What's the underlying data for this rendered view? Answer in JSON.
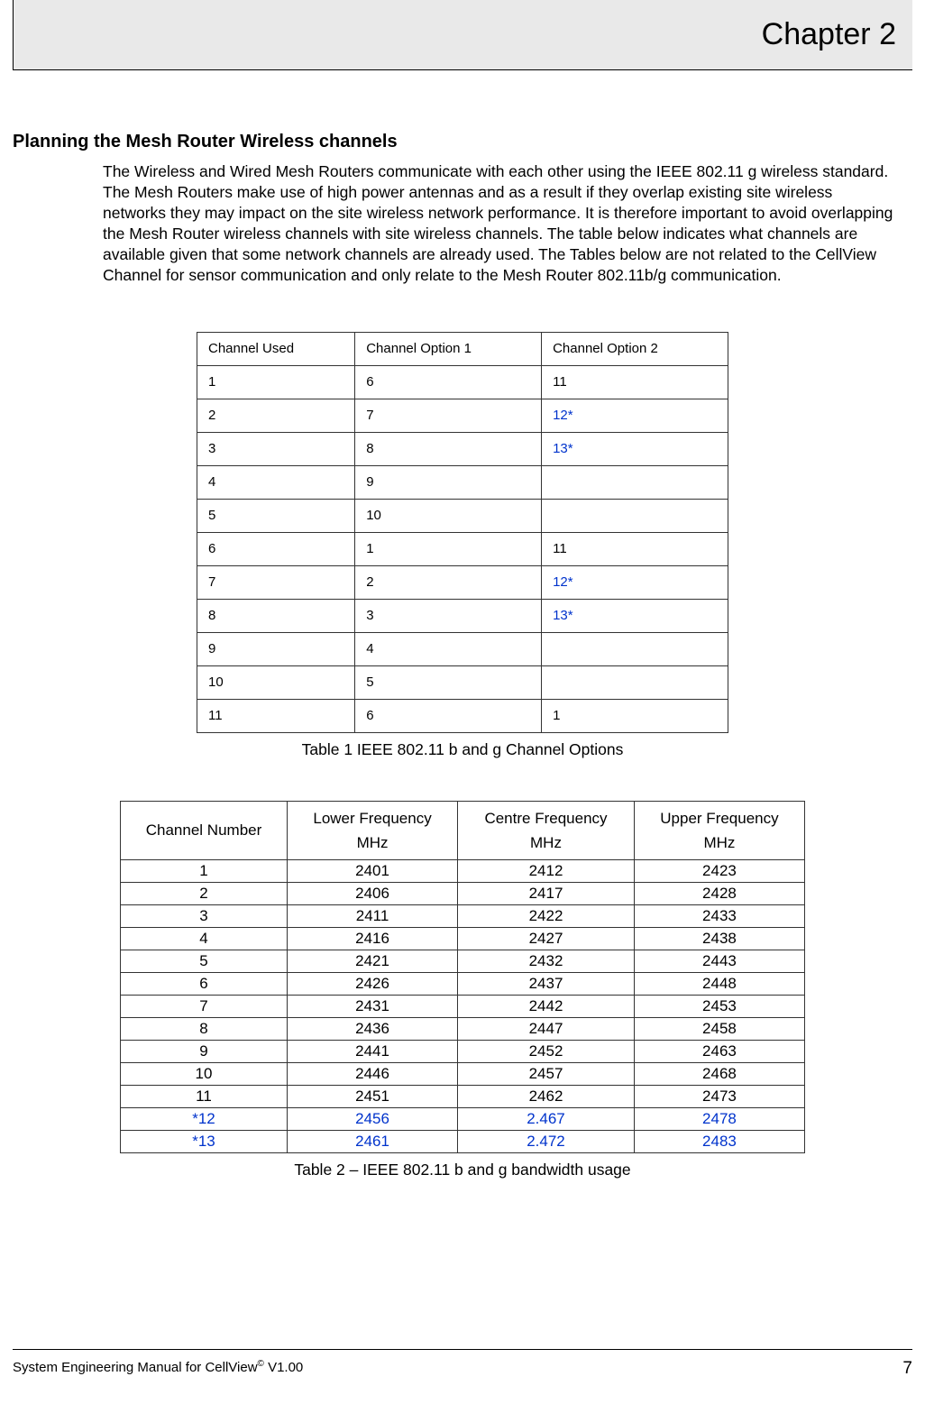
{
  "header": {
    "chapter": "Chapter 2"
  },
  "section": {
    "title": "Planning the Mesh Router Wireless channels",
    "body": "The Wireless and Wired Mesh Routers communicate with each other using the IEEE 802.11 g wireless standard. The Mesh Routers make use of high power antennas and as a result if they overlap existing site wireless networks they may impact on the site wireless network performance. It is therefore important to avoid overlapping the Mesh Router wireless channels with site wireless channels. The table below indicates what channels are available given that some network channels are already used. The Tables below are not related to the CellView Channel for sensor communication and only relate to the Mesh Router 802.11b/g communication."
  },
  "table1": {
    "headers": [
      "Channel Used",
      "Channel Option 1",
      "Channel Option 2"
    ],
    "rows": [
      {
        "c1": "1",
        "c2": "6",
        "c3": "11",
        "c3blue": false
      },
      {
        "c1": "2",
        "c2": "7",
        "c3": "12*",
        "c3blue": true
      },
      {
        "c1": "3",
        "c2": "8",
        "c3": "13*",
        "c3blue": true
      },
      {
        "c1": "4",
        "c2": "9",
        "c3": "",
        "c3blue": false
      },
      {
        "c1": "5",
        "c2": "10",
        "c3": "",
        "c3blue": false
      },
      {
        "c1": "6",
        "c2": "1",
        "c3": "11",
        "c3blue": false
      },
      {
        "c1": "7",
        "c2": "2",
        "c3": "12*",
        "c3blue": true
      },
      {
        "c1": "8",
        "c2": "3",
        "c3": "13*",
        "c3blue": true
      },
      {
        "c1": "9",
        "c2": "4",
        "c3": "",
        "c3blue": false
      },
      {
        "c1": "10",
        "c2": "5",
        "c3": "",
        "c3blue": false
      },
      {
        "c1": "11",
        "c2": "6",
        "c3": "1",
        "c3blue": false
      }
    ],
    "caption": "Table 1  IEEE 802.11 b and g Channel Options"
  },
  "table2": {
    "headers": [
      {
        "top": "Channel Number",
        "sub": ""
      },
      {
        "top": "Lower Frequency",
        "sub": "MHz"
      },
      {
        "top": "Centre Frequency",
        "sub": "MHz"
      },
      {
        "top": "Upper Frequency",
        "sub": "MHz"
      }
    ],
    "rows": [
      {
        "c1": "1",
        "c2": "2401",
        "c3": "2412",
        "c4": "2423",
        "blue": false
      },
      {
        "c1": "2",
        "c2": "2406",
        "c3": "2417",
        "c4": "2428",
        "blue": false
      },
      {
        "c1": "3",
        "c2": "2411",
        "c3": "2422",
        "c4": "2433",
        "blue": false
      },
      {
        "c1": "4",
        "c2": "2416",
        "c3": "2427",
        "c4": "2438",
        "blue": false
      },
      {
        "c1": "5",
        "c2": "2421",
        "c3": "2432",
        "c4": "2443",
        "blue": false
      },
      {
        "c1": "6",
        "c2": "2426",
        "c3": "2437",
        "c4": "2448",
        "blue": false
      },
      {
        "c1": "7",
        "c2": "2431",
        "c3": "2442",
        "c4": "2453",
        "blue": false
      },
      {
        "c1": "8",
        "c2": "2436",
        "c3": "2447",
        "c4": "2458",
        "blue": false
      },
      {
        "c1": "9",
        "c2": "2441",
        "c3": "2452",
        "c4": "2463",
        "blue": false
      },
      {
        "c1": "10",
        "c2": "2446",
        "c3": "2457",
        "c4": "2468",
        "blue": false
      },
      {
        "c1": "11",
        "c2": "2451",
        "c3": "2462",
        "c4": "2473",
        "blue": false
      },
      {
        "c1": "*12",
        "c2": "2456",
        "c3": "2.467",
        "c4": "2478",
        "blue": true
      },
      {
        "c1": "*13",
        "c2": "2461",
        "c3": "2.472",
        "c4": "2483",
        "blue": true
      }
    ],
    "caption": "Table 2 – IEEE 802.11 b and g bandwidth usage"
  },
  "footer": {
    "left_pre": "System Engineering Manual for CellView",
    "left_sup": "©",
    "left_post": " V1.00",
    "page": "7"
  }
}
